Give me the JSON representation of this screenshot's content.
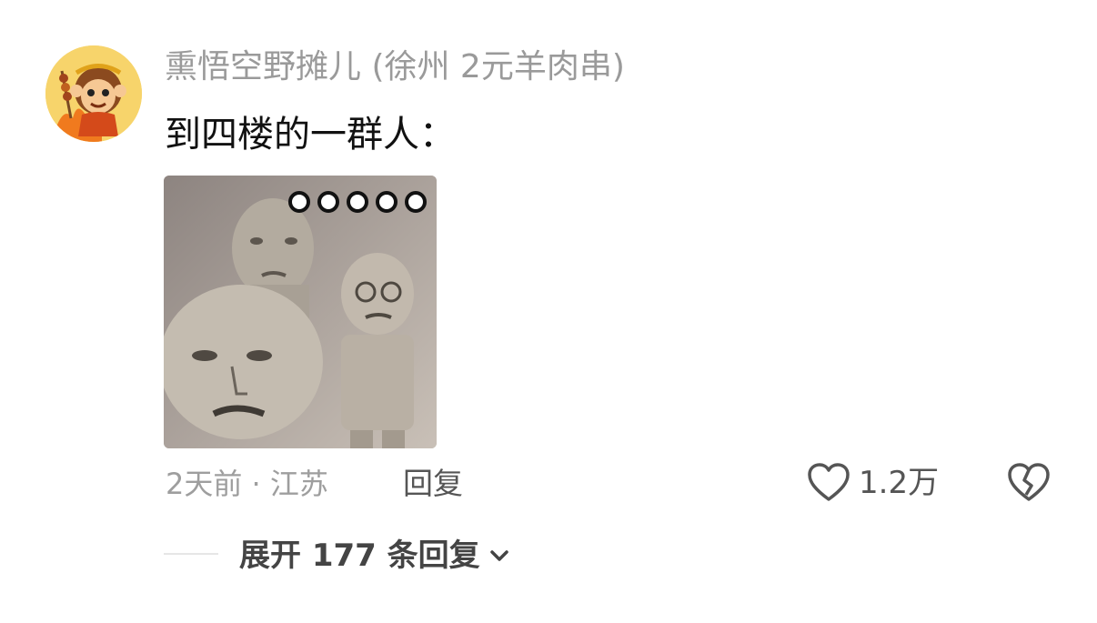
{
  "comment": {
    "username": "熏悟空野摊儿 (徐州 2元羊肉串)",
    "text": "到四楼的一群人：",
    "meta": "2天前 · 江苏",
    "reply_label": "回复",
    "likes": "1.2万",
    "expand_label": "展开 177 条回复"
  },
  "icons": {
    "like": "heart-outline-icon",
    "dislike": "broken-heart-icon",
    "expand": "chevron-down-icon",
    "more": "more-dots-icon"
  },
  "colors": {
    "username": "#9a9a9a",
    "text": "#111111",
    "meta": "#9e9e9e"
  }
}
